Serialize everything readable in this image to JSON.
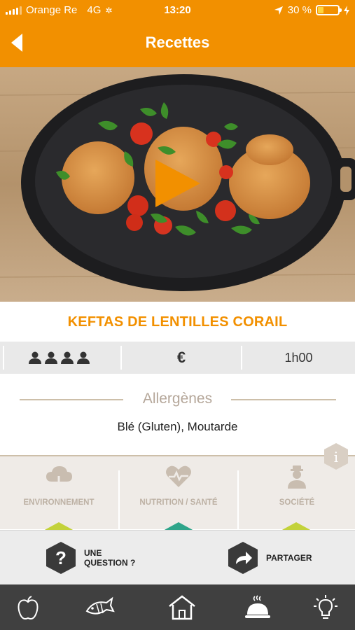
{
  "status_bar": {
    "carrier": "Orange Re",
    "network": "4G",
    "time": "13:20",
    "battery": "30 %",
    "battery_level": 0.3
  },
  "header": {
    "title": "Recettes"
  },
  "recipe": {
    "title": "KEFTAS DE LENTILLES CORAIL",
    "price": "€",
    "duration": "1h00",
    "servings_icons": 4
  },
  "allergens": {
    "heading": "Allergènes",
    "list": "Blé (Gluten), Moutarde"
  },
  "categories": [
    {
      "label": "ENVIRONNEMENT",
      "icon": "cloud-icon",
      "indicator_color": "#c3d23a"
    },
    {
      "label": "NUTRITION / SANTÉ",
      "icon": "heart-pulse-icon",
      "indicator_color": "#2fa58a"
    },
    {
      "label": "SOCIÉTÉ",
      "icon": "person-icon",
      "indicator_color": "#c3d23a"
    }
  ],
  "actions": {
    "question_line1": "UNE",
    "question_line2": "QUESTION ?",
    "share": "PARTAGER"
  },
  "nav": {
    "items": [
      "apple-icon",
      "fish-icon",
      "home-icon",
      "cloche-icon",
      "lightbulb-icon"
    ]
  },
  "colors": {
    "brand": "#f29000",
    "nav_bg": "#404040"
  }
}
